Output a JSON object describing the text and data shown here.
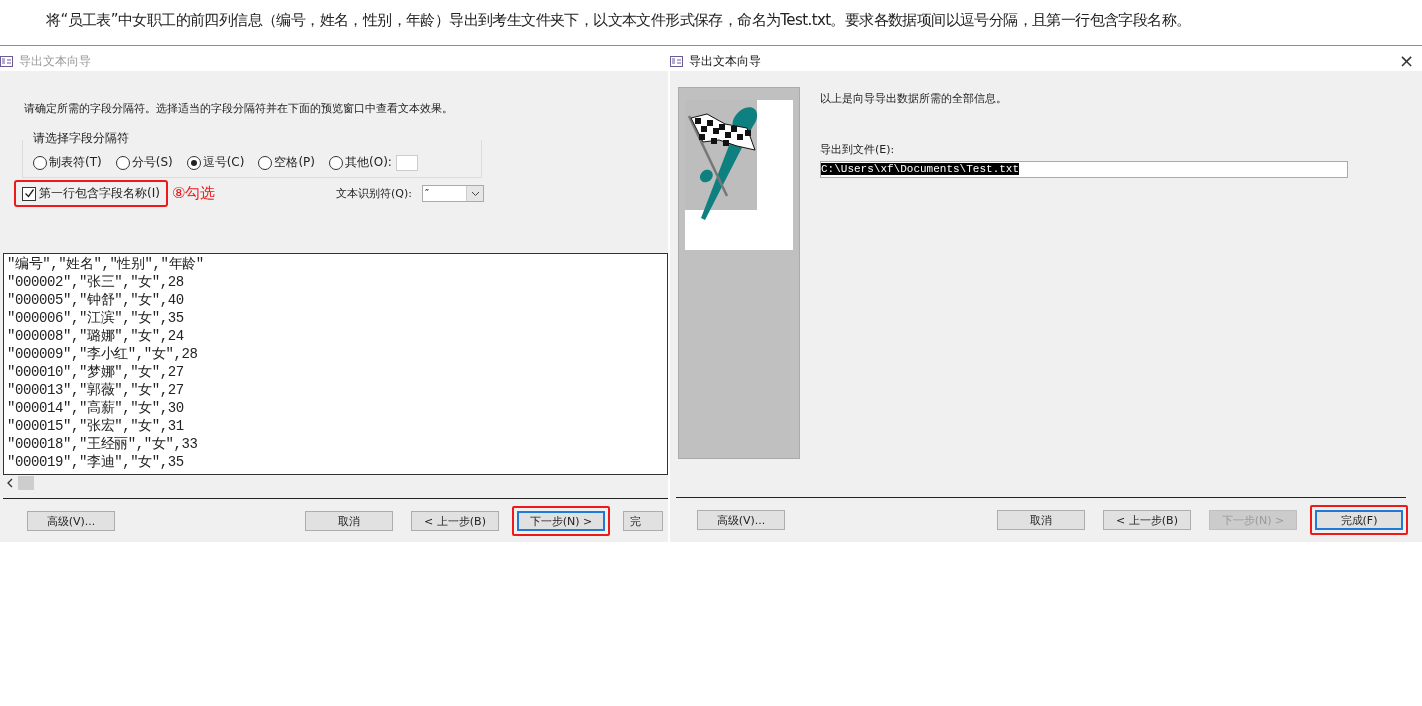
{
  "instruction": "将“员工表”中女职工的前四列信息（编号，姓名，性别，年龄）导出到考生文件夹下，以文本文件形式保存，命名为Test.txt。要求各数据项间以逗号分隔，且第一行包含字段名称。",
  "left_dialog": {
    "title": "导出文本向导",
    "active": false,
    "description": "请确定所需的字段分隔符。选择适当的字段分隔符并在下面的预览窗口中查看文本效果。",
    "delimiter_group": {
      "legend": "请选择字段分隔符",
      "options": [
        {
          "label": "制表符(T)",
          "selected": false
        },
        {
          "label": "分号(S)",
          "selected": false
        },
        {
          "label": "逗号(C)",
          "selected": true
        },
        {
          "label": "空格(P)",
          "selected": false
        },
        {
          "label": "其他(O):",
          "selected": false
        }
      ]
    },
    "header_checkbox": {
      "label": "第一行包含字段名称(I)",
      "checked": true,
      "highlighted": true
    },
    "annotation": "⑧勾选",
    "qualifier": {
      "label": "文本识别符(Q):",
      "value": "″"
    },
    "preview_lines": [
      "″编号″,″姓名″,″性别″,″年龄″",
      "″000002″,″张三″,″女″,28",
      "″000005″,″钟舒″,″女″,40",
      "″000006″,″江滨″,″女″,35",
      "″000008″,″璐娜″,″女″,24",
      "″000009″,″李小红″,″女″,28",
      "″000010″,″梦娜″,″女″,27",
      "″000013″,″郭薇″,″女″,27",
      "″000014″,″高薪″,″女″,30",
      "″000015″,″张宏″,″女″,31",
      "″000018″,″王经丽″,″女″,33",
      "″000019″,″李迪″,″女″,35"
    ],
    "buttons": [
      {
        "label": "高级(V)...",
        "disabled": false,
        "default": false,
        "highlighted": false
      },
      {
        "label": "取消",
        "disabled": false,
        "default": false,
        "highlighted": false
      },
      {
        "label": "< 上一步(B)",
        "disabled": false,
        "default": false,
        "highlighted": false
      },
      {
        "label": "下一步(N) >",
        "disabled": false,
        "default": true,
        "highlighted": true
      },
      {
        "label": "完",
        "disabled": false,
        "default": false,
        "highlighted": false
      }
    ]
  },
  "right_dialog": {
    "title": "导出文本向导",
    "active": true,
    "close": "×",
    "message": "以上是向导导出数据所需的全部信息。",
    "file_label": "导出到文件(E):",
    "file_value": "C:\\Users\\xf\\Documents\\Test.txt",
    "buttons": [
      {
        "label": "高级(V)...",
        "disabled": false,
        "default": false,
        "highlighted": false
      },
      {
        "label": "取消",
        "disabled": false,
        "default": false,
        "highlighted": false
      },
      {
        "label": "< 上一步(B)",
        "disabled": false,
        "default": false,
        "highlighted": false
      },
      {
        "label": "下一步(N) >",
        "disabled": true,
        "default": false,
        "highlighted": false
      },
      {
        "label": "完成(F)",
        "disabled": false,
        "default": true,
        "highlighted": true
      }
    ]
  }
}
